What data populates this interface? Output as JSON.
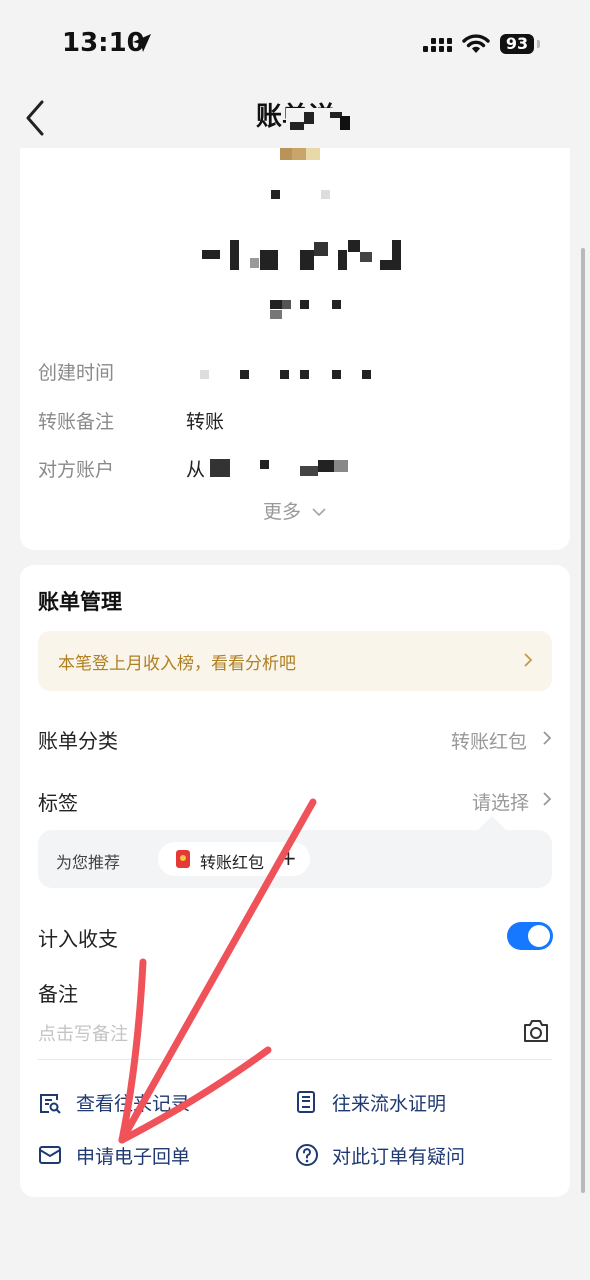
{
  "status_bar": {
    "time": "13:10",
    "battery": "93"
  },
  "nav": {
    "title": "账单详"
  },
  "detail": {
    "rows": [
      {
        "label": "创建时间",
        "value": ""
      },
      {
        "label": "转账备注",
        "value": "转账"
      },
      {
        "label": "对方账户",
        "value": "从"
      }
    ],
    "more_label": "更多"
  },
  "manage": {
    "title": "账单管理",
    "banner_text": "本笔登上月收入榜，看看分析吧",
    "category": {
      "label": "账单分类",
      "value": "转账红包"
    },
    "tag": {
      "label": "标签",
      "value": "请选择"
    },
    "recommend": {
      "label": "为您推荐",
      "chip": "转账红包",
      "chip_plus": "+"
    },
    "count_in": {
      "label": "计入收支",
      "enabled": true
    },
    "note": {
      "label": "备注",
      "placeholder": "点击写备注"
    },
    "actions": [
      {
        "label": "查看往来记录",
        "icon": "record-search-icon"
      },
      {
        "label": "往来流水证明",
        "icon": "statement-doc-icon"
      },
      {
        "label": "申请电子回单",
        "icon": "envelope-icon"
      },
      {
        "label": "对此订单有疑问",
        "icon": "question-circle-icon"
      }
    ]
  },
  "colors": {
    "accent": "#1677ff",
    "banner_bg": "#faf5ea",
    "banner_text": "#b07f22",
    "action_text": "#1f3a73",
    "annotation_arrow": "#f0525a"
  }
}
